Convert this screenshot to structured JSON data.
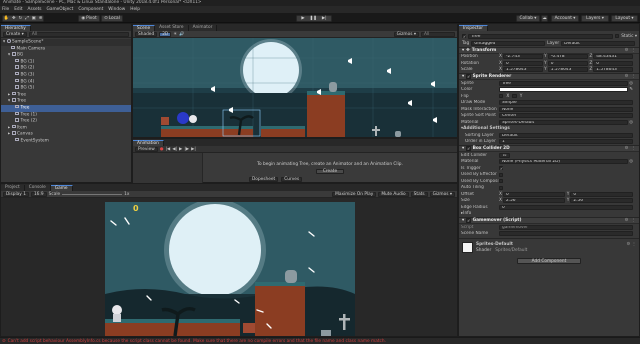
{
  "app": {
    "title": "Animate - SampleScene - PC, Mac & Linux Standalone - Unity 2018.4.0f1 Personal* <DX11>"
  },
  "menus": [
    "File",
    "Edit",
    "Assets",
    "GameObject",
    "Component",
    "Window",
    "Help"
  ],
  "toolbar": {
    "pivot": "Pivot",
    "space": "Local",
    "collab": "Collab ▾",
    "account": "Account ▾",
    "layers": "Layers ▾",
    "layout": "Layout ▾"
  },
  "hierarchy": {
    "tab": "Hierarchy",
    "create": "Create ▾",
    "search_placeholder": "All",
    "items": [
      "SampleScene*",
      "Main Camera",
      "BG",
      "BG (1)",
      "BG (2)",
      "BG (3)",
      "BG (4)",
      "BG (5)",
      "Tree",
      "Tree",
      "Tree",
      "Tree (1)",
      "Tree (2)",
      "Item",
      "Canvas",
      "EventSystem"
    ]
  },
  "scene": {
    "tabs": [
      "Scene",
      "Asset Store",
      "Animator"
    ],
    "shaded": "Shaded",
    "mode2d": "2D",
    "gizmos": "Gizmos ▾",
    "search_placeholder": "All"
  },
  "animation": {
    "tab": "Animation",
    "preview": "Preview",
    "message": "To begin animating Tree, create an Animator and an Animation Clip.",
    "create_button": "Create",
    "dopesheet": "Dopesheet",
    "curves": "Curves"
  },
  "bottom": {
    "tabs": [
      "Project",
      "Console",
      "Game"
    ],
    "display": "Display 1",
    "aspect": "16:9",
    "scale_label": "Scale",
    "scale_value": "1x",
    "maximize": "Maximize On Play",
    "mute": "Mute Audio",
    "stats": "Stats",
    "gizmos": "Gizmos ▾"
  },
  "game": {
    "score_icons": "0"
  },
  "status": {
    "error": "Can't add script behaviour AssemblyInfo.cs because the script class cannot be found. Make sure that there are no compile errors and that the file name and class name match."
  },
  "inspector": {
    "tab": "Inspector",
    "object_name": "Tree",
    "static_label": "Static ▾",
    "tag_label": "Tag",
    "tag_value": "Untagged",
    "layer_label": "Layer",
    "layer_value": "Default",
    "transform": {
      "title": "Transform",
      "position_label": "Position",
      "position": {
        "x": "-2.743",
        "y": "-0.478",
        "z": "48.43431"
      },
      "rotation_label": "Rotation",
      "rotation": {
        "x": "0",
        "y": "0",
        "z": "0"
      },
      "scale_label": "Scale",
      "scale": {
        "x": "1.578643",
        "y": "1.578643",
        "z": "1.578643"
      }
    },
    "sprite_renderer": {
      "title": "Sprite Renderer",
      "sprite_label": "Sprite",
      "sprite_value": "Tree",
      "color_label": "Color",
      "flip_label": "Flip",
      "flip_x": "X",
      "flip_y": "Y",
      "draw_mode_label": "Draw Mode",
      "draw_mode_value": "Simple",
      "mask_label": "Mask Interaction",
      "mask_value": "None",
      "sort_point_label": "Sprite Sort Point",
      "sort_point_value": "Center",
      "material_label": "Material",
      "material_value": "Sprites-Default",
      "additional": "Additional Settings",
      "sorting_layer_label": "Sorting Layer",
      "sorting_layer_value": "Default",
      "order_label": "Order in Layer",
      "order_value": "1"
    },
    "box_collider": {
      "title": "Box Collider 2D",
      "edit_label": "Edit Collider",
      "material_label": "Material",
      "material_value": "None (Physics Material 2D)",
      "trigger_label": "Is Trigger",
      "effector_label": "Used By Effector",
      "composite_label": "Used By Composite",
      "tiling_label": "Auto Tiling",
      "offset_label": "Offset",
      "offset": {
        "x": "0",
        "y": "0"
      },
      "size_label": "Size",
      "size": {
        "x": "2.56",
        "y": "2.56"
      },
      "edge_label": "Edge Radius",
      "edge_value": "0",
      "info_label": "Info"
    },
    "gamemover": {
      "title": "Gamemover (Script)",
      "script_label": "Script",
      "script_value": "gamemover",
      "scene_label": "Scene Name"
    },
    "material_card": {
      "name": "Sprites-Default",
      "shader_label": "Shader",
      "shader_value": "Sprites/Default"
    },
    "add_component": "Add Component"
  },
  "colors": {
    "accent": "#4d86d8",
    "panel": "#383838",
    "sky": "#2f5a64",
    "moon": "#dff0f7",
    "ground": "#8b3d22",
    "error": "#d13f3f"
  }
}
